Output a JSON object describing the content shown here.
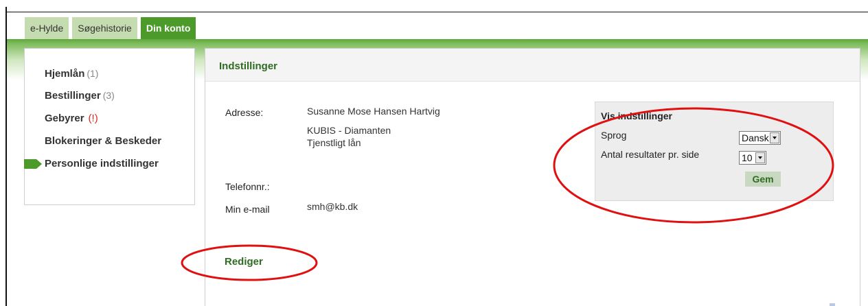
{
  "tabs": [
    {
      "label": "e-Hylde"
    },
    {
      "label": "Søgehistorie"
    },
    {
      "label": "Din konto"
    }
  ],
  "sidebar": {
    "items": [
      {
        "label": "Hjemlån",
        "count": "(1)"
      },
      {
        "label": "Bestillinger",
        "count": "(3)"
      },
      {
        "label": "Gebyrer",
        "warning": "(!)"
      },
      {
        "label": "Blokeringer & Beskeder"
      },
      {
        "label": "Personlige indstillinger"
      }
    ]
  },
  "main": {
    "title": "Indstillinger",
    "address_label": "Adresse:",
    "address_name": "Susanne Mose Hansen Hartvig",
    "address_line2": "KUBIS - Diamanten",
    "address_line3": "Tjenstligt lån",
    "phone_label": "Telefonnr.:",
    "email_label": "Min e-mail",
    "email_value": "smh@kb.dk",
    "edit_link": "Rediger"
  },
  "settings": {
    "title": "Vis indstillinger",
    "language_label": "Sprog",
    "language_value": "Dansk",
    "results_label": "Antal resultater pr. side",
    "results_value": "10",
    "save_label": "Gem"
  },
  "colors": {
    "accent_green": "#4c9a2a",
    "link_green": "#2f6b22",
    "highlight_red": "#e01010",
    "warning_red": "#d42a20"
  }
}
